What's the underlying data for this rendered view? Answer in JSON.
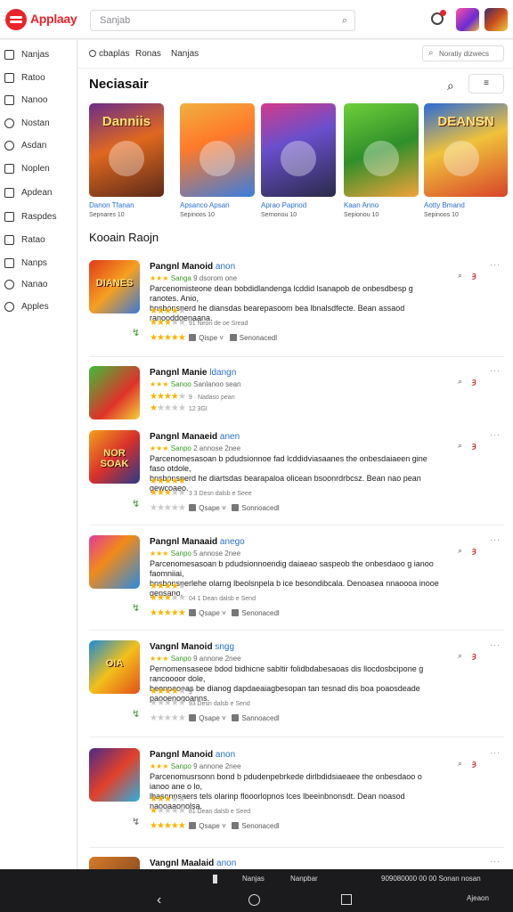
{
  "app": {
    "brand": "Applaay"
  },
  "search": {
    "placeholder": "Sanjab"
  },
  "sidebar": {
    "items": [
      {
        "label": "Nanjas"
      },
      {
        "label": "Ratoo"
      },
      {
        "label": "Nanoo"
      },
      {
        "label": "Nostan"
      },
      {
        "label": "Asdan"
      },
      {
        "label": "Noplen"
      },
      {
        "label": "Apdean"
      },
      {
        "label": "Raspdes"
      },
      {
        "label": "Ratao"
      },
      {
        "label": "Nanps"
      },
      {
        "label": "Nanao"
      },
      {
        "label": "Apples"
      }
    ]
  },
  "filters": {
    "tabs": [
      "cbaplas",
      "Ronas",
      "Nanjas"
    ],
    "sort": "Noratiy dizwecs"
  },
  "featured": {
    "title": "Neciasair",
    "button": "≡",
    "cards": [
      {
        "art": "Danniis",
        "title": "Danon Tfanan",
        "sub": "Sepnares 10"
      },
      {
        "art": "",
        "title": "Apsanco Apsan",
        "sub": "Sepinoos 10"
      },
      {
        "art": "",
        "title": "Aprao Papnod",
        "sub": "Sernonou 10"
      },
      {
        "art": "",
        "title": "Kaan Anno",
        "sub": "Sepionou 10"
      },
      {
        "art": "DEANSN",
        "title": "Aotty Bmand",
        "sub": "Sepinoos 10"
      }
    ]
  },
  "reviews_section": {
    "title": "Kooain Raojn"
  },
  "reviews": [
    {
      "icon_text": "DIANES",
      "title": "Pangnl Manoid",
      "tag": "anon",
      "meta_g": "Sanga",
      "meta": "9 dsorom one",
      "body": [
        "Parcenomisteone dean bobdidlandenga lcddid lsanapob de onbesdbesp g ranotes. Anio,",
        "bnsbonsnerd he diansdas bearepasoom bea lbnalsdfecte. Bean assaod ranooddgenaana."
      ],
      "note1": "",
      "note2": "91 Neon de oe Sread",
      "reply": "Qispe",
      "report": "Senonacedl",
      "opt": "⌕",
      "flag": "ȝ"
    },
    {
      "icon_text": "",
      "title": "Pangnl Manie",
      "tag": "ldangn",
      "meta_g": "Sanoo",
      "meta": "Sanlanoo sean",
      "body": [],
      "note1": "9 · Nadaso pean",
      "note2": "12 3GI",
      "reply": "",
      "report": "",
      "opt": "⌕",
      "flag": "ȝ"
    },
    {
      "icon_text": "NOR SOAK",
      "title": "Pangnl Manaeid",
      "tag": "anen",
      "meta_g": "Sanpo",
      "meta": "2 annose 2nee",
      "body": [
        "Parcenomesasoan b pdudsionnoe fad lcddidviasaanes the onbesdaiaeen gine faso otdole,",
        "bnsbonsnerd he diartsdas bearapaloa olicean bsoonrdrbcsz. Bean nao pean gewcoaeo."
      ],
      "note1": "3 3  Desn dalsb e  Seee",
      "note2": "",
      "reply": "Qsape",
      "report": "Sonnoacedl",
      "opt": "⌕",
      "flag": "ȝ"
    },
    {
      "icon_text": "",
      "title": "Pangnl Manaaid",
      "tag": "anego",
      "meta_g": "Sanpo",
      "meta": "5 annose 2nee",
      "body": [
        "Parcenomesasoan b pdudsionnoendig daiaeao saspeob the onbesdaoo g ianoo faomniiai,",
        "bnsbonsnerlehe olarng lbeolsnpela b ice besondibcala. Denoasea nnaoooa inooe gensano."
      ],
      "note1": "04  1  Dean dalsb e  Send",
      "note2": "",
      "reply": "Qsape",
      "report": "Senonacedl",
      "opt": "⌕",
      "flag": "ȝ"
    },
    {
      "icon_text": "OIA",
      "title": "Vangnl Manoid",
      "tag": "sngg",
      "meta_g": "Sanpo",
      "meta": "9 annone 2nee",
      "body": [
        "Pernomensaseoe bdod bidhicne sabltir folidbdabesaoas dis llocdosbcipone g rancoooor dole,",
        "beonpaoeas be dianog dapdaeaiagbesopan tan tesnad dis boa poaosdeade paooenogoanns."
      ],
      "note1": "9",
      "note2": "93  Desn dalsb e  Send",
      "reply": "Qsape",
      "report": "Sannoacedl",
      "opt": "⌕",
      "flag": "ȝ"
    },
    {
      "icon_text": "",
      "title": "Pangnl Manoid",
      "tag": "anon",
      "meta_g": "Sanpo",
      "meta": "9 annone 2nee",
      "body": [
        "Parcenomusrsonn bond b pdudenpebrkede dirlbdidsiaeaee the onbesdaoo o ianoo ane o lo,",
        "lbasonnsaers tels olarinp flooorlopnos lces lbeeinbnonsdt. Dean noasod naooaaonolsa."
      ],
      "note1": "81  Dean dalsb e  Seed",
      "note2": "",
      "reply": "Qsape",
      "report": "Senonacedl",
      "opt": "⌕",
      "flag": "ȝ"
    },
    {
      "icon_text": "",
      "title": "Vangnl Maalaid",
      "tag": "anon",
      "meta_g": "",
      "meta": "",
      "body": [],
      "note1": "",
      "note2": "",
      "reply": "",
      "report": "",
      "opt": "",
      "flag": ""
    }
  ],
  "bottom": {
    "tab1": "Nanjas",
    "tab2": "Nanpbar",
    "status": "909080000 00  00  Sonan nosan",
    "right": "Ajeaon"
  }
}
